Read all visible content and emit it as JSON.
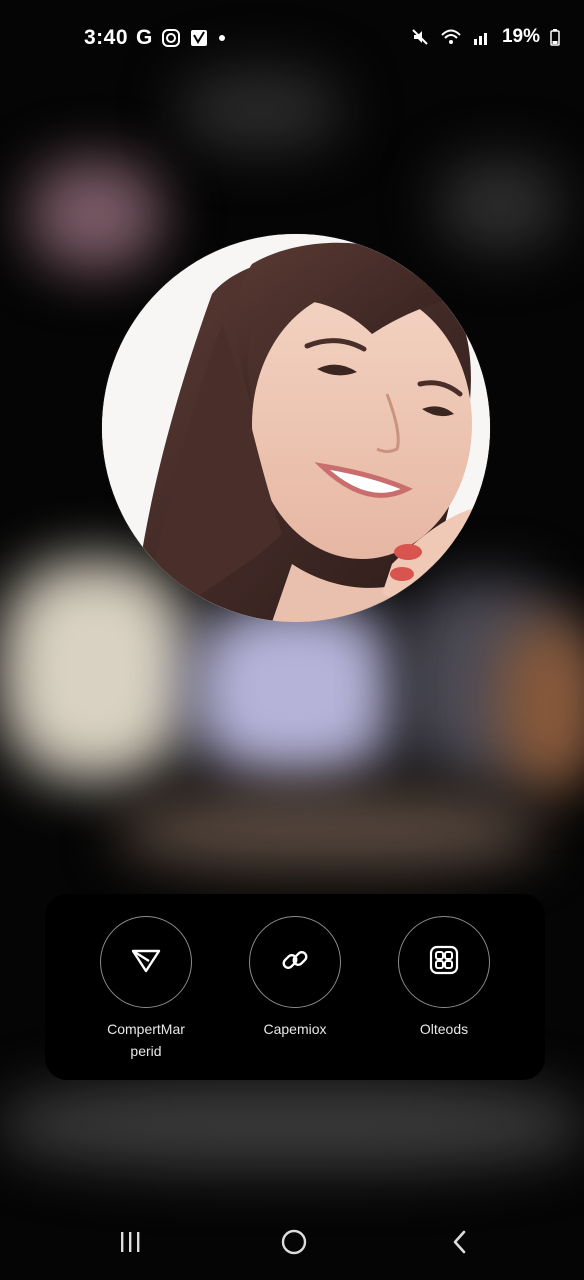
{
  "status_bar": {
    "time": "3:40",
    "network_letter": "G",
    "battery": "19%",
    "left_icons": [
      "google-icon",
      "instagram-icon",
      "checkbox-app-icon",
      "dot-icon"
    ],
    "right_icons": [
      "mute-icon",
      "wifi-icon",
      "signal-icon"
    ]
  },
  "share_sheet": {
    "actions": [
      {
        "label": "CompertMar\nperid",
        "icon": "send-icon"
      },
      {
        "label": "Capemiox",
        "icon": "link-icon"
      },
      {
        "label": "Olteods",
        "icon": "qr-code-icon"
      }
    ]
  },
  "nav_bar": {
    "buttons": [
      "recent-apps-icon",
      "home-icon",
      "back-icon"
    ]
  },
  "colors": {
    "background": "#050505",
    "sheet": "#000000",
    "text": "#ffffff"
  }
}
